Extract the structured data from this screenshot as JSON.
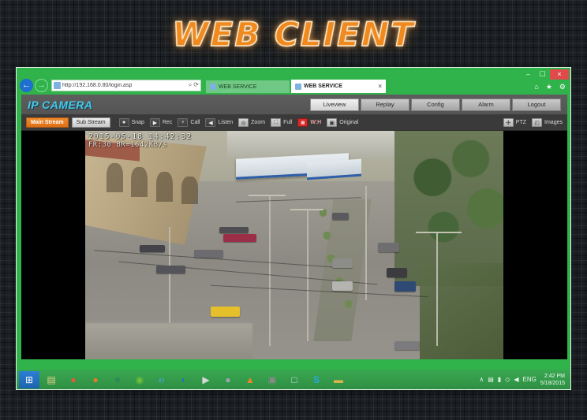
{
  "banner": {
    "title": "WEB CLIENT"
  },
  "browser": {
    "window_controls": {
      "minimize": "–",
      "maximize": "☐",
      "close": "×"
    },
    "back_icon": "←",
    "forward_icon": "→",
    "address": {
      "url_prefix": "http://",
      "url_host": "192.168.0.80",
      "url_path": "/login.asp",
      "url_full": "http://192.168.0.80/login.asp",
      "search_icon": "⌕",
      "refresh_icon": "⟳"
    },
    "tabs": [
      {
        "label": "WEB SERVICE",
        "active": false
      },
      {
        "label": "WEB SERVICE",
        "active": true,
        "close": "×"
      }
    ],
    "tools": [
      {
        "name": "home-icon",
        "glyph": "⌂"
      },
      {
        "name": "favorites-icon",
        "glyph": "★"
      },
      {
        "name": "settings-icon",
        "glyph": "⚙"
      }
    ]
  },
  "app": {
    "logo": "IP CAMERA",
    "nav": [
      {
        "label": "Liveview",
        "active": true
      },
      {
        "label": "Replay",
        "active": false
      },
      {
        "label": "Config",
        "active": false
      },
      {
        "label": "Alarm",
        "active": false
      },
      {
        "label": "Logout",
        "active": false
      }
    ],
    "toolbar": {
      "main_stream": "Main Stream",
      "sub_stream": "Sub Stream",
      "items": [
        {
          "label": "Snap",
          "icon": "camera-icon",
          "glyph": "●"
        },
        {
          "label": "Rec",
          "icon": "record-icon",
          "glyph": "▶"
        },
        {
          "label": "Call",
          "icon": "microphone-icon",
          "glyph": "♀"
        },
        {
          "label": "Listen",
          "icon": "speaker-icon",
          "glyph": "◀"
        },
        {
          "label": "Zoom",
          "icon": "zoom-icon",
          "glyph": "◎"
        },
        {
          "label": "Full",
          "icon": "fullscreen-icon",
          "glyph": "⛶"
        },
        {
          "label": "W:H",
          "icon": "aspect-ratio-icon",
          "glyph": "▤"
        },
        {
          "label": "Original",
          "icon": "original-size-icon",
          "glyph": "▣"
        }
      ],
      "right_items": [
        {
          "label": "PTZ",
          "icon": "ptz-icon",
          "glyph": "✣"
        },
        {
          "label": "Images",
          "icon": "images-icon",
          "glyph": "◰"
        }
      ]
    },
    "video_osd": {
      "line1": "2015-05-18  14:42:32",
      "line2": "FR:30  BR=1642KB/s"
    }
  },
  "taskbar": {
    "start_icon": "⊞",
    "icons": [
      {
        "name": "file-explorer-icon",
        "glyph": "▤",
        "color": "#e8d48a"
      },
      {
        "name": "chrome-icon",
        "glyph": "●",
        "color": "#e55a3a"
      },
      {
        "name": "firefox-icon",
        "glyph": "●",
        "color": "#e8792a"
      },
      {
        "name": "office-icon",
        "glyph": "■",
        "color": "#2e8b57"
      },
      {
        "name": "nvidia-icon",
        "glyph": "◉",
        "color": "#6fbf3a"
      },
      {
        "name": "internet-explorer-icon",
        "glyph": "℮",
        "color": "#4aa8e0"
      },
      {
        "name": "opera-icon",
        "glyph": "◐",
        "color": "#2f6fb0"
      },
      {
        "name": "media-player-icon",
        "glyph": "▶",
        "color": "#d8d8d8"
      },
      {
        "name": "steam-icon",
        "glyph": "●",
        "color": "#9aa7b0"
      },
      {
        "name": "vlc-icon",
        "glyph": "▲",
        "color": "#e8862a"
      },
      {
        "name": "camera-app-icon",
        "glyph": "▣",
        "color": "#8a8a8a"
      },
      {
        "name": "notepad-icon",
        "glyph": "□",
        "color": "#cfd6dc"
      },
      {
        "name": "skype-icon",
        "glyph": "S",
        "color": "#29a8e0"
      },
      {
        "name": "folder-icon",
        "glyph": "▬",
        "color": "#d9b24c"
      }
    ],
    "tray": {
      "show_hidden": "∧",
      "network_icon": "▤",
      "battery_icon": "▮",
      "volume_icon": "◀",
      "action_icon": "◇",
      "language": "ENG",
      "time": "2:42 PM",
      "date": "5/18/2015"
    }
  },
  "colors": {
    "banner_orange": "#f08a1e",
    "browser_green": "#2fb34a",
    "logo_cyan": "#49c8e8",
    "stream_active_orange": "#ef8a2e",
    "aspect_red": "#d52b2b"
  }
}
